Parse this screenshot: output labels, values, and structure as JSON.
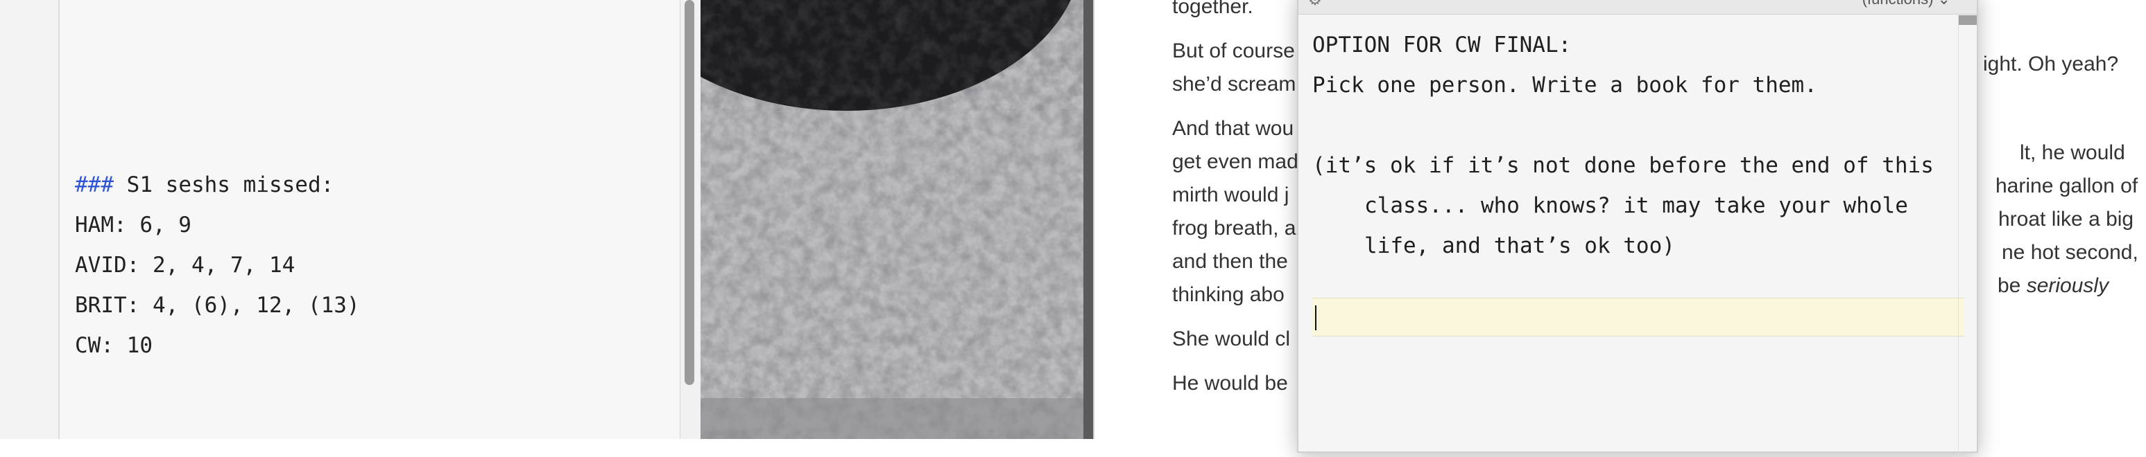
{
  "editor": {
    "heading_marker": "###",
    "heading_text": " S1 seshs missed:",
    "lines": [
      "HAM: 6, 9",
      "AVID: 2, 4, 7, 14",
      "BRIT: 4, (6), 12, (13)",
      "CW: 10"
    ]
  },
  "popup": {
    "functions_label": "(functions) ⌄",
    "lines": [
      "OPTION FOR CW FINAL:",
      "Pick one person. Write a book for them.",
      "",
      "(it’s ok if it’s not done before the end of this",
      "class... who knows? it may take your whole",
      "life, and that’s ok too)"
    ],
    "input_value": ""
  },
  "document": {
    "left_fragments": [
      "together.",
      "But of course",
      "she’d scream",
      "And that wou",
      "get even mad",
      "mirth would j",
      "frog breath, a",
      "and then the",
      "thinking abo",
      "She would cl",
      "He would be"
    ],
    "right_fragments": [
      "ight. Oh yeah?",
      "lt, he would",
      "harine gallon of",
      "hroat like a big",
      "ne hot second,",
      "be",
      "seriously"
    ]
  },
  "colors": {
    "markdown_heading": "#2f55d4",
    "input_highlight": "#fbf7dc"
  }
}
